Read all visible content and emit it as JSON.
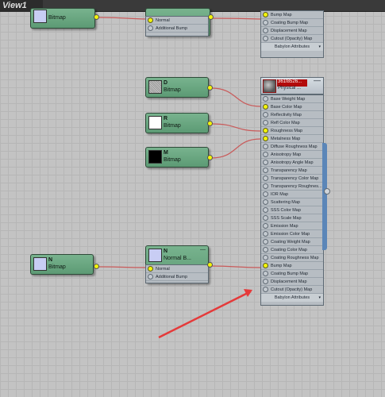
{
  "viewport": {
    "tab_label": "View1"
  },
  "nodes": {
    "top_bitmap": {
      "type": "Bitmap"
    },
    "top_normal_bump": {
      "slots": [
        "Normal",
        "Additional Bump"
      ]
    },
    "top_material": {
      "slots": [
        "Bump Map",
        "Coating Bump Map",
        "Displacement Map",
        "Cutout (Opacity) Map"
      ],
      "footer": "Babylon Attributes"
    },
    "bitmap_d": {
      "title": "D",
      "type": "Bitmap"
    },
    "bitmap_r": {
      "title": "R",
      "type": "Bitmap"
    },
    "bitmap_m": {
      "title": "M",
      "type": "Bitmap"
    },
    "bitmap_n": {
      "title": "N",
      "type": "Bitmap"
    },
    "normal_bump_n": {
      "title": "N",
      "type": "Normal B...",
      "slots": [
        "Normal",
        "Additional Bump"
      ]
    },
    "physical_material": {
      "title": "361f8526...",
      "type": "Physical ...",
      "slots": [
        "Base Weight Map",
        "Base Color Map",
        "Reflectivity Map",
        "Refl Color Map",
        "Roughness Map",
        "Metalness Map",
        "Diffuse Roughness Map",
        "Anisotropy Map",
        "Anisotropy Angle Map",
        "Transparency Map",
        "Transparency Color Map",
        "Transparency Roughnes...",
        "IOR Map",
        "Scattering Map",
        "SSS Color Map",
        "SSS Scale Map",
        "Emission Map",
        "Emission Color Map",
        "Coating Weight Map",
        "Coating Color Map",
        "Coating Roughness Map",
        "Bump Map",
        "Coating Bump Map",
        "Displacement Map",
        "Cutout (Opacity) Map"
      ],
      "connected_slots": [
        "Base Color Map",
        "Roughness Map",
        "Metalness Map",
        "Bump Map"
      ],
      "footer": "Babylon Attributes"
    }
  },
  "colors": {
    "node_green": "#6aa882",
    "port_yellow": "#f2f40a",
    "wire_red": "#c95a5a",
    "material_header_red": "#b30b0b",
    "annotation_arrow": "#e53a3a"
  }
}
